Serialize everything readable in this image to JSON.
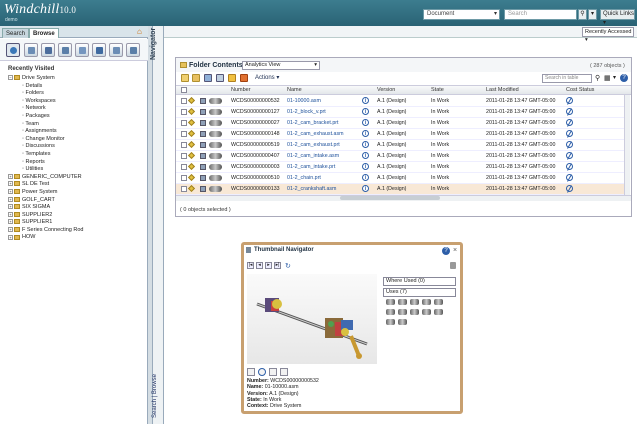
{
  "app": {
    "logo": "Windchill",
    "version": "10.0",
    "user": "demo",
    "search_type": "Document",
    "search_placeholder": "Search",
    "quick_links": "Quick Links"
  },
  "left": {
    "tabs": [
      "Search",
      "Browse"
    ],
    "recently_visited_label": "Recently Visited",
    "tree": [
      {
        "label": "Drive System",
        "level": 0,
        "kind": "root",
        "expanded": true
      },
      {
        "label": "Details",
        "level": 1
      },
      {
        "label": "Folders",
        "level": 1
      },
      {
        "label": "Workspaces",
        "level": 1
      },
      {
        "label": "Network",
        "level": 1
      },
      {
        "label": "Packages",
        "level": 1
      },
      {
        "label": "Team",
        "level": 1
      },
      {
        "label": "Assignments",
        "level": 1
      },
      {
        "label": "Change Monitor",
        "level": 1
      },
      {
        "label": "Discussions",
        "level": 1
      },
      {
        "label": "Templates",
        "level": 1
      },
      {
        "label": "Reports",
        "level": 1
      },
      {
        "label": "Utilities",
        "level": 1
      },
      {
        "label": "GENERIC_COMPUTER",
        "level": 0,
        "kind": "root"
      },
      {
        "label": "SL DE Test",
        "level": 0,
        "kind": "root"
      },
      {
        "label": "Power System",
        "level": 0,
        "kind": "root"
      },
      {
        "label": "GOLF_CART",
        "level": 0,
        "kind": "root"
      },
      {
        "label": "SIX SIGMA",
        "level": 0,
        "kind": "root"
      },
      {
        "label": "SUPPLIER2",
        "level": 0,
        "kind": "root"
      },
      {
        "label": "SUPPLIER1",
        "level": 0,
        "kind": "root"
      },
      {
        "label": "F Series Connecting Rod",
        "level": 0,
        "kind": "root"
      },
      {
        "label": "HOW",
        "level": 0,
        "kind": "root"
      }
    ],
    "navigator_label": "Navigator",
    "bottom_links": "Search | Browse"
  },
  "main": {
    "recently_accessed": "Recently Accessed",
    "folder_title": "Folder Contents",
    "view": "Analytics View",
    "object_count": "( 287 objects )",
    "actions": "Actions",
    "filter_placeholder": "Search in table",
    "columns": [
      "Number",
      "Name",
      "Version",
      "State",
      "Last Modified",
      "Cost Status"
    ],
    "rows": [
      {
        "number": "WCDS00000000532",
        "name": "01-10000.asm",
        "version": "A.1 (Design)",
        "state": "In Work",
        "modified": "2011-01-28 13:47 GMT-05:00",
        "selected": false
      },
      {
        "number": "WCDS00000000127",
        "name": "01-2_block_v.prt",
        "version": "A.1 (Design)",
        "state": "In Work",
        "modified": "2011-01-28 13:47 GMT-05:00",
        "selected": false
      },
      {
        "number": "WCDS00000000027",
        "name": "01-2_cam_bracket.prt",
        "version": "A.1 (Design)",
        "state": "In Work",
        "modified": "2011-01-28 13:47 GMT-05:00",
        "selected": false
      },
      {
        "number": "WCDS00000000148",
        "name": "01-2_cam_exhaust.asm",
        "version": "A.1 (Design)",
        "state": "In Work",
        "modified": "2011-01-28 13:47 GMT-05:00",
        "selected": false
      },
      {
        "number": "WCDS00000000519",
        "name": "01-2_cam_exhaust.prt",
        "version": "A.1 (Design)",
        "state": "In Work",
        "modified": "2011-01-28 13:47 GMT-05:00",
        "selected": false
      },
      {
        "number": "WCDS00000000407",
        "name": "01-2_cam_intake.asm",
        "version": "A.1 (Design)",
        "state": "In Work",
        "modified": "2011-01-28 13:47 GMT-05:00",
        "selected": false
      },
      {
        "number": "WCDS00000000003",
        "name": "01-2_cam_intake.prt",
        "version": "A.1 (Design)",
        "state": "In Work",
        "modified": "2011-01-28 13:47 GMT-05:00",
        "selected": false
      },
      {
        "number": "WCDS00000000510",
        "name": "01-2_chain.prt",
        "version": "A.1 (Design)",
        "state": "In Work",
        "modified": "2011-01-28 13:47 GMT-05:00",
        "selected": false
      },
      {
        "number": "WCDS00000000133",
        "name": "01-2_crankshaft.asm",
        "version": "A.1 (Design)",
        "state": "In Work",
        "modified": "2011-01-28 13:47 GMT-05:00",
        "selected": true
      }
    ],
    "selection_status": "( 0 objects selected )"
  },
  "thumb": {
    "title": "Thumbnail Navigator",
    "where_used": "Where Used (0)",
    "uses": "Uses (7)",
    "info": {
      "number_label": "Number:",
      "number": "WCDS00000000532",
      "name_label": "Name:",
      "name": "01-10000.asm",
      "version_label": "Version:",
      "version": "A.1 (Design)",
      "state_label": "State:",
      "state": "In Work",
      "context_label": "Context:",
      "context": "Drive System"
    }
  },
  "colors": {
    "topbar": "#2f6b7d",
    "link": "#1c4f9a",
    "selected_row": "#f8e8d6",
    "popup_border": "#c8a070"
  }
}
